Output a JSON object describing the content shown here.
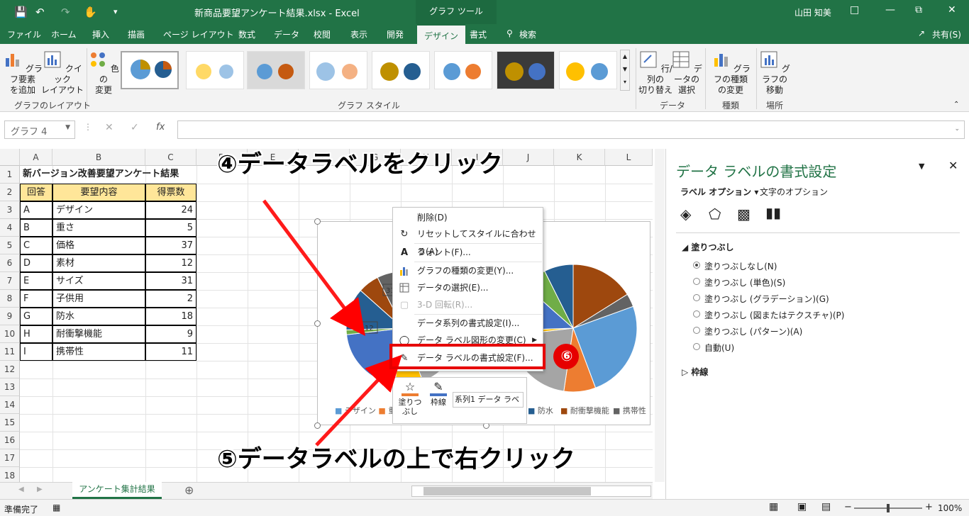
{
  "titlebar": {
    "title": "新商品要望アンケート結果.xlsx  -  Excel",
    "context_tab": "グラフ ツール",
    "user": "山田 知美"
  },
  "tabs": [
    "ファイル",
    "ホーム",
    "挿入",
    "描画",
    "ページ レイアウト",
    "数式",
    "データ",
    "校閲",
    "表示",
    "開発",
    "デザイン",
    "書式"
  ],
  "tell_me": "検索",
  "share": "共有(S)",
  "ribbon": {
    "add_element": "グラフ要素\nを追加",
    "quick_layout": "クイック\nレイアウト",
    "change_color": "色の\n変更",
    "group_layout": "グラフのレイアウト",
    "group_style": "グラフ スタイル",
    "switch_rowcol": "行/列の\n切り替え",
    "select_data": "データの\n選択",
    "group_data": "データ",
    "change_type": "グラフの種類\nの変更",
    "group_type": "種類",
    "move_chart": "グラフの\n移動",
    "group_location": "場所"
  },
  "namebox": "グラフ 4",
  "columns": [
    "A",
    "B",
    "C",
    "D",
    "E",
    "F",
    "G",
    "H",
    "I",
    "J",
    "K",
    "L"
  ],
  "rows": [
    "1",
    "2",
    "3",
    "4",
    "5",
    "6",
    "7",
    "8",
    "9",
    "10",
    "11",
    "12",
    "13",
    "14",
    "15",
    "16",
    "17",
    "18"
  ],
  "table": {
    "title": "新バージョン改善要望アンケート結果",
    "headers": [
      "回答",
      "要望内容",
      "得票数"
    ],
    "rows": [
      [
        "A",
        "デザイン",
        "24"
      ],
      [
        "B",
        "重さ",
        "5"
      ],
      [
        "C",
        "価格",
        "37"
      ],
      [
        "D",
        "素材",
        "12"
      ],
      [
        "E",
        "サイズ",
        "31"
      ],
      [
        "F",
        "子供用",
        "2"
      ],
      [
        "G",
        "防水",
        "18"
      ],
      [
        "H",
        "耐衝撃機能",
        "9"
      ],
      [
        "I",
        "携帯性",
        "11"
      ]
    ]
  },
  "chart_data": {
    "type": "pie",
    "categories": [
      "デザイン",
      "重さ",
      "価格",
      "素材",
      "サイズ",
      "子供用",
      "防水",
      "耐衝撃機能",
      "携帯性"
    ],
    "values": [
      24,
      5,
      37,
      12,
      31,
      2,
      18,
      9,
      11
    ],
    "visible_labels": [
      "31",
      "12"
    ],
    "legend_visible": [
      "デザイン",
      "重",
      "防水",
      "耐衝撃機能",
      "携帯性"
    ],
    "colors": [
      "#5b9bd5",
      "#ed7d31",
      "#a5a5a5",
      "#ffc000",
      "#4472c4",
      "#70ad47",
      "#255e91",
      "#9e480e",
      "#636363"
    ]
  },
  "context_menu": [
    {
      "label": "削除(D)",
      "icon": "",
      "disabled": false
    },
    {
      "label": "リセットしてスタイルに合わせる(A)",
      "icon": "reset",
      "disabled": false
    },
    {
      "label": "フォント(F)...",
      "icon": "A",
      "disabled": false
    },
    {
      "label": "グラフの種類の変更(Y)...",
      "icon": "chart",
      "disabled": false
    },
    {
      "label": "データの選択(E)...",
      "icon": "data",
      "disabled": false
    },
    {
      "label": "3-D 回転(R)...",
      "icon": "3d",
      "disabled": true
    },
    {
      "label": "データ系列の書式設定(I)...",
      "icon": "",
      "disabled": false
    },
    {
      "label": "データ ラベル図形の変更(C)",
      "icon": "shape",
      "disabled": false
    },
    {
      "label": "データ ラベルの書式設定(F)...",
      "icon": "format",
      "disabled": false
    }
  ],
  "minibar": {
    "fill": "塗りつ\nぶし",
    "outline": "枠線",
    "series": "系列1 データ ラベ"
  },
  "pane": {
    "title": "データ ラベルの書式設定",
    "tab_label": "ラベル オプション",
    "tab_text": "文字のオプション",
    "section_fill": "塗りつぶし",
    "options": [
      "塗りつぶしなし(N)",
      "塗りつぶし (単色)(S)",
      "塗りつぶし (グラデーション)(G)",
      "塗りつぶし (図またはテクスチャ)(P)",
      "塗りつぶし (パターン)(A)",
      "自動(U)"
    ],
    "section_border": "枠線"
  },
  "sheet_tab": "アンケート集計結果",
  "status": {
    "ready": "準備完了",
    "zoom": "100%"
  },
  "annotations": {
    "a4": "④データラベルをクリック",
    "a5": "⑤データラベルの上で右クリック",
    "a6": "⑥"
  }
}
